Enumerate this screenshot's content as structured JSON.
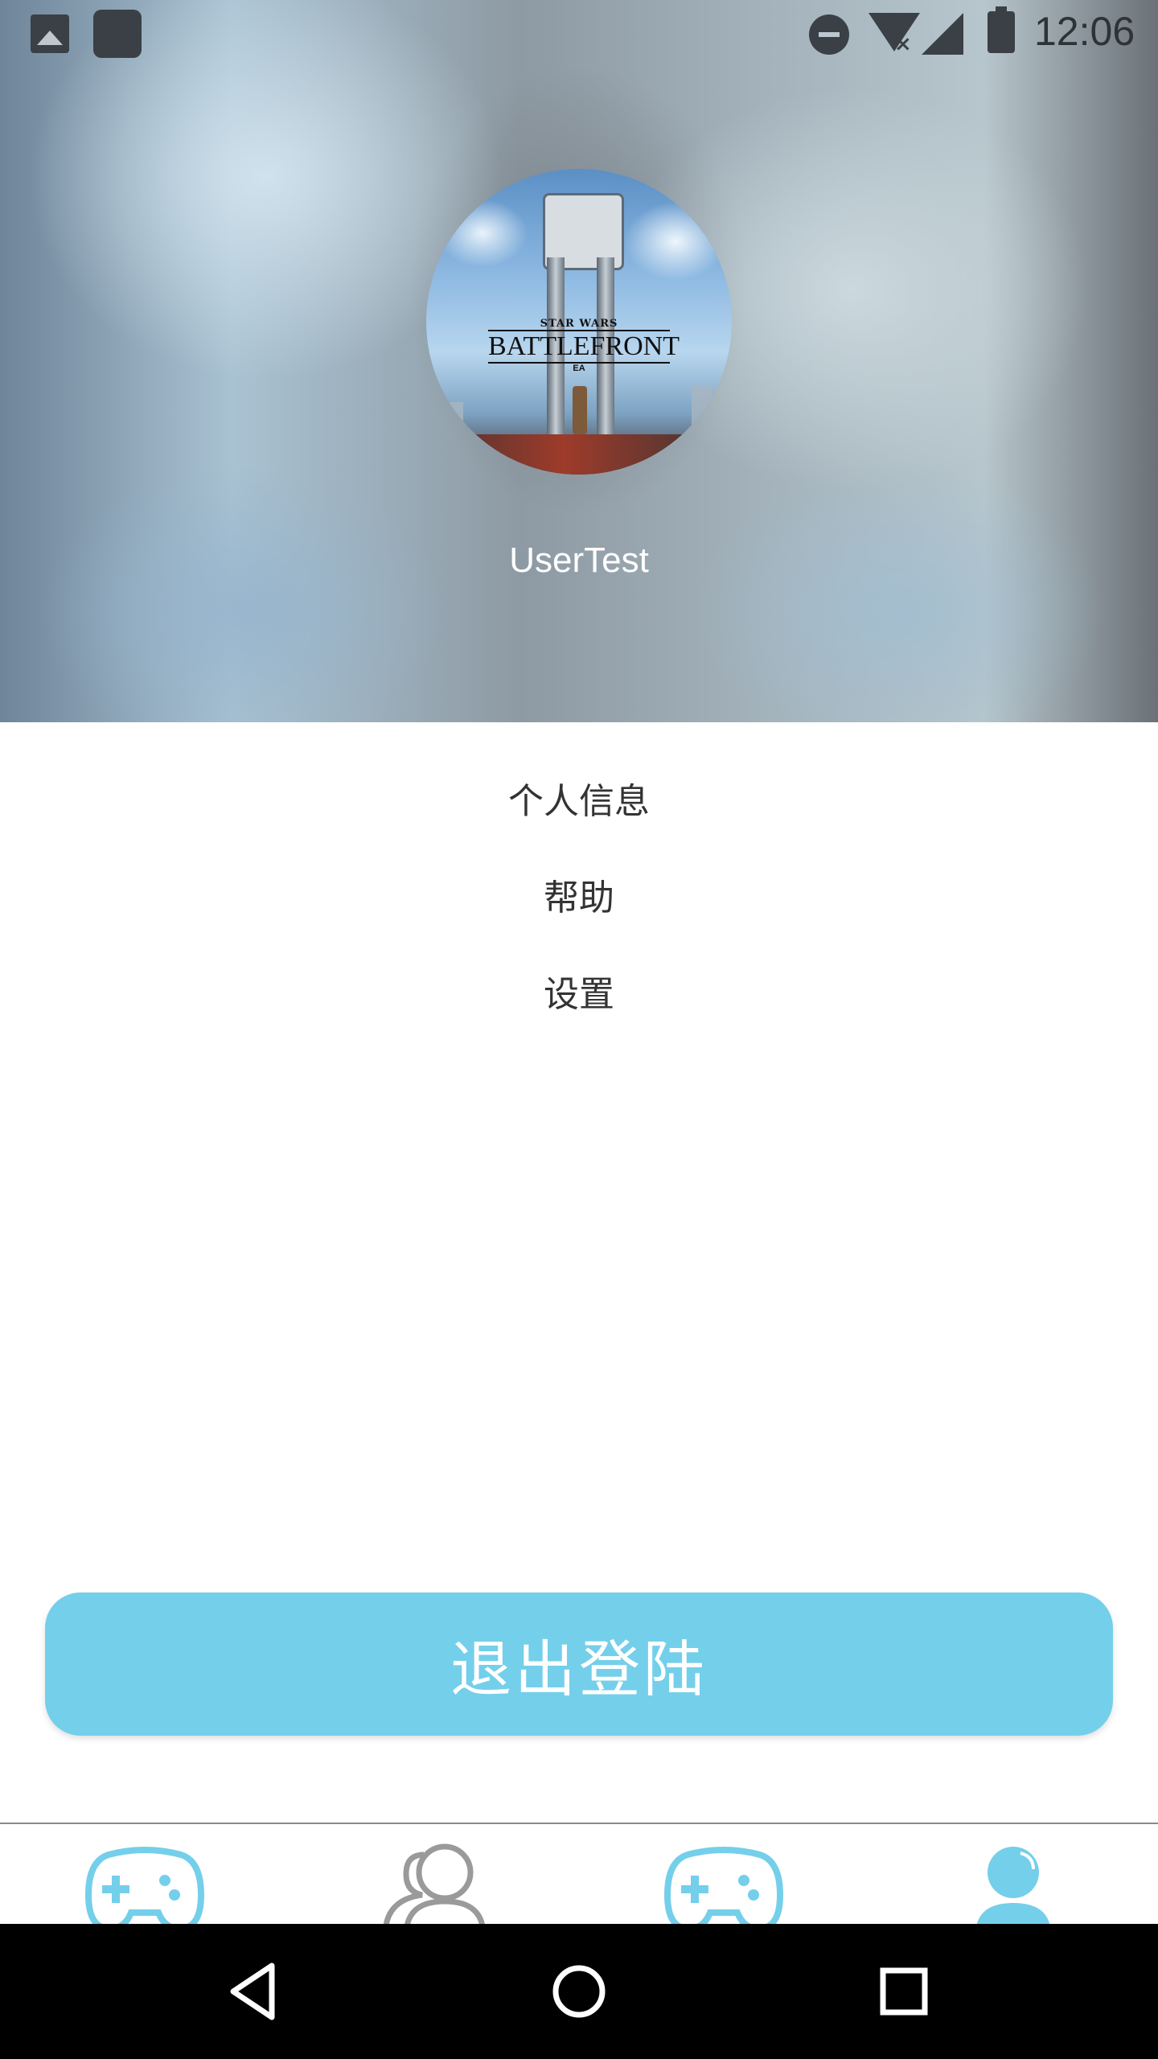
{
  "status_bar": {
    "time": "12:06",
    "icons": [
      "gallery-icon",
      "app-square-icon",
      "do-not-disturb-icon",
      "wifi-no-internet-icon",
      "cell-signal-icon",
      "battery-icon"
    ]
  },
  "profile": {
    "avatar_logo_small": "STAR WARS",
    "avatar_logo_title": "BATTLEFRONT",
    "avatar_logo_brand": "EA",
    "username": "UserTest"
  },
  "menu": {
    "items": [
      {
        "label": "个人信息"
      },
      {
        "label": "帮助"
      },
      {
        "label": "设置"
      }
    ]
  },
  "logout": {
    "label": "退出登陆"
  },
  "tabbar": {
    "accent_color": "#74cfea",
    "inactive_color": "#9a9a9a",
    "tabs": [
      {
        "icon": "gamepad-icon",
        "active": false
      },
      {
        "icon": "friends-icon",
        "active": false
      },
      {
        "icon": "gamepad-icon",
        "active": false
      },
      {
        "icon": "user-icon",
        "active": true
      }
    ]
  },
  "navbar": {
    "buttons": [
      "back-icon",
      "home-icon",
      "recents-icon"
    ]
  }
}
